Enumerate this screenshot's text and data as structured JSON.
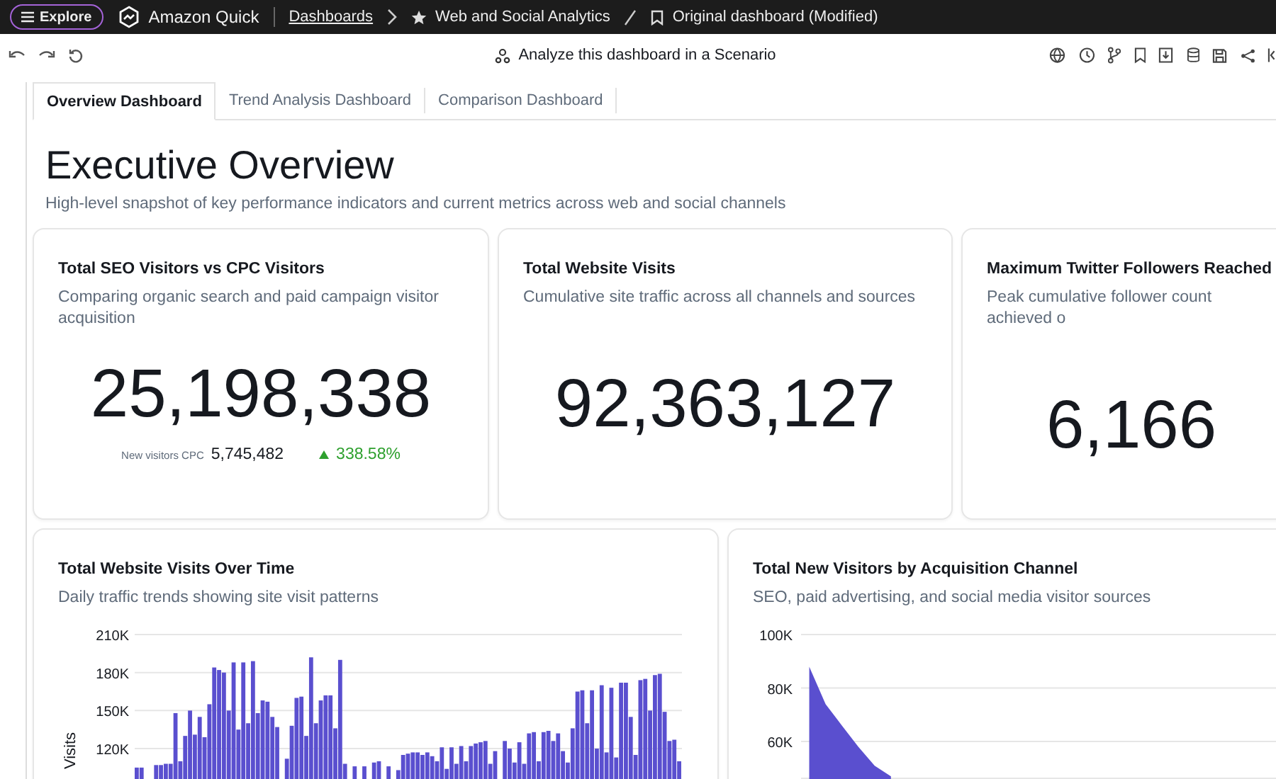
{
  "topbar": {
    "explore_button": "Explore",
    "app_name": "Amazon Quick",
    "breadcrumbs": [
      {
        "label": "Dashboards",
        "kind": "link"
      },
      {
        "label": "Web and Social Analytics",
        "kind": "starred"
      },
      {
        "label": "Original dashboard (Modified)",
        "kind": "bookmarked"
      }
    ]
  },
  "toolbar": {
    "scenario_button": "Analyze this dashboard in a Scenario"
  },
  "tabs": [
    {
      "label": "Overview Dashboard",
      "selected": true
    },
    {
      "label": "Trend Analysis Dashboard",
      "selected": false
    },
    {
      "label": "Comparison Dashboard",
      "selected": false
    }
  ],
  "page": {
    "title": "Executive Overview",
    "subtitle": "High-level snapshot of key performance indicators and current metrics across web and social channels"
  },
  "kpis": [
    {
      "title": "Total SEO Visitors vs CPC Visitors",
      "subtitle": "Comparing organic search and paid campaign visitor acquisition",
      "value": "25,198,338",
      "comparison": {
        "label": "New visitors CPC",
        "value": "5,745,482",
        "change": "338.58%",
        "increase": true
      }
    },
    {
      "title": "Total Website Visits",
      "subtitle": "Cumulative site traffic across all channels and sources",
      "value": "92,363,127"
    },
    {
      "title": "Maximum Twitter Followers Reached",
      "subtitle": "Peak cumulative follower count achieved o",
      "value": "6,166"
    }
  ],
  "charts": [
    {
      "title": "Total Website Visits Over Time",
      "subtitle": "Daily traffic trends showing site visit patterns",
      "chart_data": {
        "type": "bar",
        "ylabel": "Visits",
        "grid": true,
        "ylim": [
          96000,
          210000
        ],
        "yticks": [
          {
            "value": 120000,
            "label": "120K"
          },
          {
            "value": 150000,
            "label": "150K"
          },
          {
            "value": 180000,
            "label": "180K"
          },
          {
            "value": 210000,
            "label": "210K"
          }
        ],
        "series": [
          {
            "color": "#5a4fcf",
            "values": [
              105000,
              105000,
              null,
              null,
              107000,
              107000,
              108000,
              108000,
              148000,
              110000,
              130000,
              150000,
              131000,
              145000,
              129000,
              155000,
              184000,
              182000,
              180000,
              150000,
              188000,
              135000,
              188000,
              140000,
              189000,
              148000,
              158000,
              157000,
              145000,
              137000,
              null,
              112000,
              138000,
              160000,
              161000,
              130000,
              192000,
              140000,
              158000,
              162000,
              162000,
              136000,
              190000,
              108000,
              null,
              106000,
              null,
              106000,
              null,
              109000,
              110000,
              null,
              106000,
              null,
              103000,
              115000,
              116000,
              117000,
              117000,
              115000,
              117000,
              114000,
              110000,
              121000,
              104000,
              121000,
              108000,
              122000,
              110000,
              122000,
              124000,
              125000,
              126000,
              108000,
              118000,
              null,
              126000,
              120000,
              109000,
              125000,
              108000,
              132000,
              133000,
              110000,
              133000,
              134000,
              126000,
              132000,
              118000,
              109000,
              136000,
              165000,
              166000,
              140000,
              166000,
              120000,
              170000,
              117000,
              168000,
              113000,
              172000,
              172000,
              145000,
              115000,
              174000,
              175000,
              150000,
              178000,
              179000,
              149000,
              126000,
              127000,
              110000
            ]
          }
        ]
      }
    },
    {
      "title": "Total New Visitors by Acquisition Channel",
      "subtitle": "SEO, paid advertising, and social media visitor sources",
      "chart_data": {
        "type": "area",
        "grid": true,
        "ylim": [
          46000,
          100000
        ],
        "yticks": [
          {
            "value": 60000,
            "label": "60K"
          },
          {
            "value": 80000,
            "label": "80K"
          },
          {
            "value": 100000,
            "label": "100K"
          }
        ],
        "series": [
          {
            "color": "#5a4fcf",
            "values": [
              88000,
              74000,
              66000,
              58000,
              51000,
              47000,
              null,
              null,
              null,
              null,
              null,
              null,
              null,
              null,
              null,
              null,
              null,
              null,
              null,
              null,
              null,
              null,
              null,
              null,
              null,
              null,
              null,
              null,
              null,
              null
            ]
          }
        ]
      }
    }
  ]
}
